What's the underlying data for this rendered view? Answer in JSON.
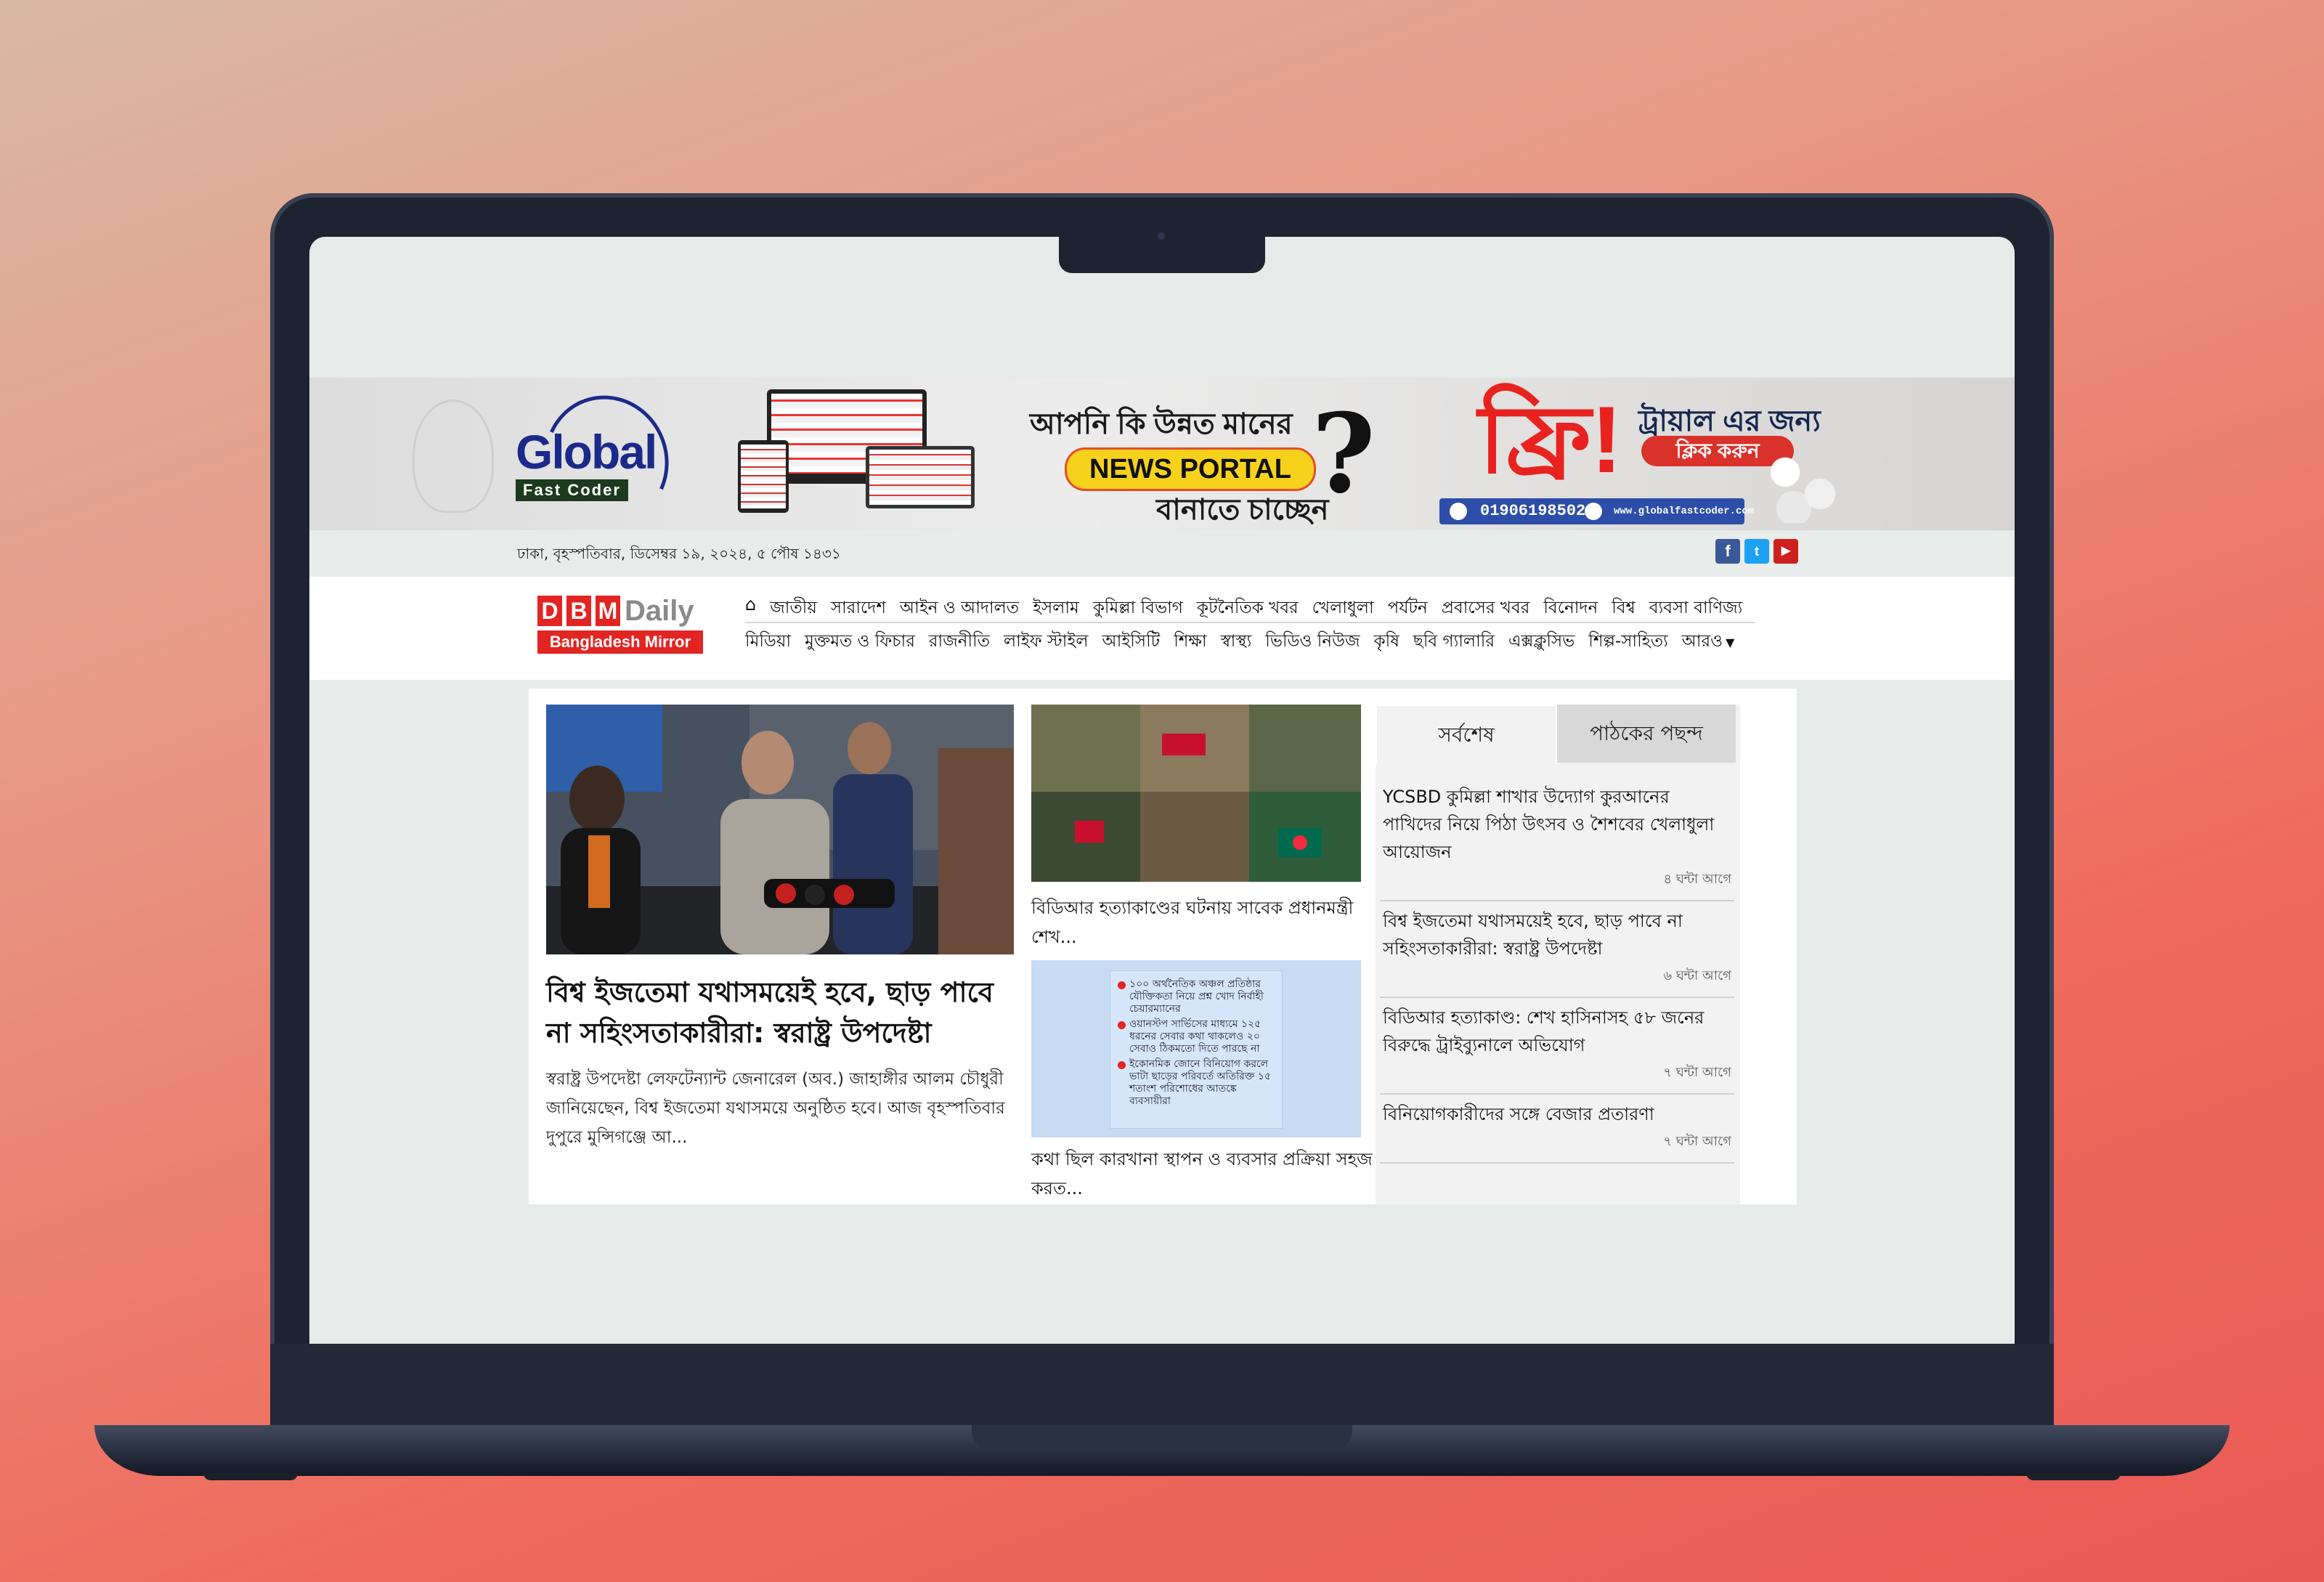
{
  "banner": {
    "brand_global": "Global",
    "brand_fast_coder": "Fast Coder",
    "question_line1": "আপনি কি উন্নত মানের",
    "news_portal": "NEWS PORTAL",
    "question_line2": "বানাতে চাচ্ছেন",
    "free_text": "ফ্রি!",
    "trial_text": "ট্রায়াল এর জন্য",
    "click_text": "ক্লিক করুন",
    "phone": "01906198502",
    "website": "www.globalfastcoder.com"
  },
  "topbar": {
    "date": "ঢাকা, বৃহস্পতিবার, ডিসেম্বর ১৯, ২০২৪, ৫ পৌষ ১৪৩১",
    "social": [
      "facebook-icon",
      "twitter-icon",
      "youtube-icon"
    ]
  },
  "site_logo": {
    "letters": [
      "D",
      "B",
      "M"
    ],
    "daily": "Daily",
    "name": "Bangladesh Mirror"
  },
  "nav": {
    "row1": [
      "জাতীয়",
      "সারাদেশ",
      "আইন ও আদালত",
      "ইসলাম",
      "কুমিল্লা বিভাগ",
      "কূটনৈতিক খবর",
      "খেলাধুলা",
      "পর্যটন",
      "প্রবাসের খবর",
      "বিনোদন",
      "বিশ্ব",
      "ব্যবসা বাণিজ্য"
    ],
    "row2": [
      "মিডিয়া",
      "মুক্তমত ও ফিচার",
      "রাজনীতি",
      "লাইফ স্টাইল",
      "আইসিটি",
      "শিক্ষা",
      "স্বাস্থ্য",
      "ভিডিও নিউজ",
      "কৃষি",
      "ছবি গ্যালারি",
      "এক্সক্লুসিভ",
      "শিল্প-সাহিত্য"
    ],
    "more": "আরও"
  },
  "lead_story": {
    "title": "বিশ্ব ইজতেমা যথাসময়েই হবে, ছাড় পাবে না সহিংসতাকারীরা: স্বরাষ্ট্র উপদেষ্টা",
    "summary": "স্বরাষ্ট্র উপদেষ্টা লেফটেন্যান্ট জেনারেল (অব.) জাহাঙ্গীর আলম চৌধুরী জানিয়েছেন, বিশ্ব ইজতেমা যথাসময়ে অনুষ্ঠিত হবে। আজ বৃহস্পতিবার দুপুরে মুন্সিগঞ্জে আ..."
  },
  "side_stories": [
    {
      "title": "বিডিআর হত্যাকাণ্ডের ঘটনায় সাবেক প্রধানমন্ত্রী শেখ..."
    },
    {
      "title": "কথা ছিল কারখানা স্থাপন ও ব্যবসার প্রক্রিয়া সহজ করত...",
      "infographic": [
        "১০০ অর্থনৈতিক অঞ্চল প্রতিষ্ঠার যৌক্তিকতা নিয়ে প্রশ্ন খোদ নির্বাহী চেয়ারম্যানের",
        "ওয়ানস্টপ সার্ভিসের মাধ্যমে ১২৫ ধরনের সেবার কথা থাকলেও ২০ সেবাও ঠিকমতো দিতে পারছে না",
        "ইকোনমিক জোনে বিনিয়োগ করলে ভাটা ছাড়ের পরিবর্তে অতিরিক্ত ১৫ শতাংশ পরিশোধের আতঙ্কে ব্যবসায়ীরা"
      ]
    }
  ],
  "tabs": {
    "latest": "সর্বশেষ",
    "popular": "পাঠকের পছন্দ"
  },
  "latest_news": [
    {
      "title": "YCSBD কুমিল্লা শাখার উদ্যোগ কুরআনের পাখিদের নিয়ে পিঠা উৎসব ও শৈশবের খেলাধুলা আয়োজন",
      "time": "৪ ঘন্টা আগে"
    },
    {
      "title": "বিশ্ব ইজতেমা যথাসময়েই হবে, ছাড় পাবে না সহিংসতাকারীরা: স্বরাষ্ট্র উপদেষ্টা",
      "time": "৬ ঘন্টা আগে"
    },
    {
      "title": "বিডিআর হত্যাকাণ্ড: শেখ হাসিনাসহ ৫৮ জনের বিরুদ্ধে ট্রাইব্যুনালে অভিযোগ",
      "time": "৭ ঘন্টা আগে"
    },
    {
      "title": "বিনিয়োগকারীদের সঙ্গে বেজার প্রতারণা",
      "time": "৭ ঘন্টা আগে"
    }
  ],
  "colors": {
    "brand_red": "#e22522",
    "facebook": "#3b5998",
    "twitter": "#1da1f2",
    "youtube": "#cd201f"
  }
}
